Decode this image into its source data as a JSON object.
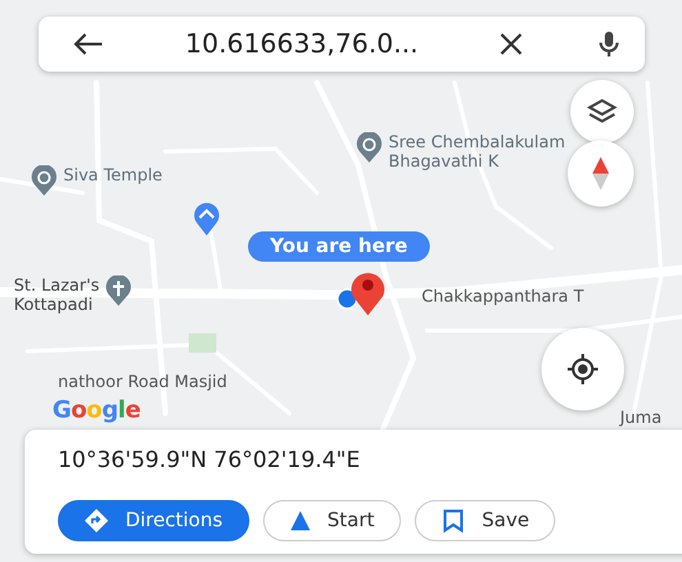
{
  "search": {
    "value": "10.616633,76.0..."
  },
  "map_labels": [
    {
      "kind": "temple",
      "lines": [
        "Siva Temple"
      ]
    },
    {
      "kind": "temple",
      "lines": [
        "Sree Chembalakulam",
        "Bhagavathi K"
      ]
    },
    {
      "kind": "church",
      "lines": [
        "St. Lazar's",
        "Kottapadi"
      ]
    },
    {
      "kind": "plain",
      "lines": [
        "Chakkappanthara T"
      ]
    },
    {
      "kind": "plain",
      "lines": [
        "nathoor Road Masjid"
      ]
    },
    {
      "kind": "plain",
      "lines": [
        "Juma"
      ]
    }
  ],
  "you_are_here": "You are here",
  "logo": "Google",
  "place": {
    "coordinates": "10°36'59.9\"N 76°02'19.4\"E"
  },
  "actions": [
    {
      "kind": "directions",
      "label": "Directions"
    },
    {
      "kind": "start",
      "label": "Start"
    },
    {
      "kind": "save",
      "label": "Save"
    }
  ]
}
